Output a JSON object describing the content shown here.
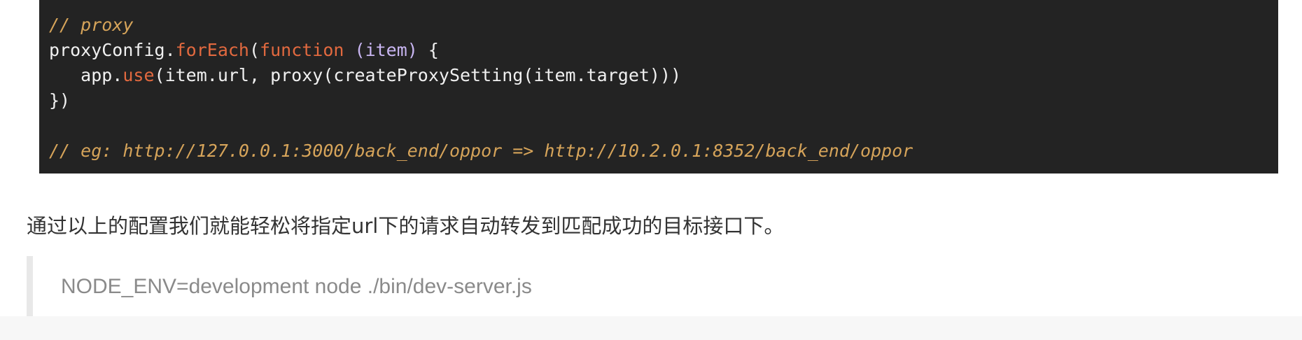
{
  "code": {
    "line1": {
      "comment": "// proxy"
    },
    "line2": {
      "obj": "proxyConfig.",
      "method": "forEach",
      "open": "(",
      "keyword": "function",
      "space": " ",
      "param": "(item)",
      "rest": " {"
    },
    "line3": {
      "indent": "   app.",
      "method": "use",
      "rest": "(item.url, proxy(createProxySetting(item.target)))"
    },
    "line4": {
      "text": "})"
    },
    "line5": {
      "text": ""
    },
    "line6": {
      "comment": "// eg: http://127.0.0.1:3000/back_end/oppor => http://10.2.0.1:8352/back_end/oppor"
    }
  },
  "paragraph": "通过以上的配置我们就能轻松将指定url下的请求自动转发到匹配成功的目标接口下。",
  "blockquote": "NODE_ENV=development node ./bin/dev-server.js"
}
